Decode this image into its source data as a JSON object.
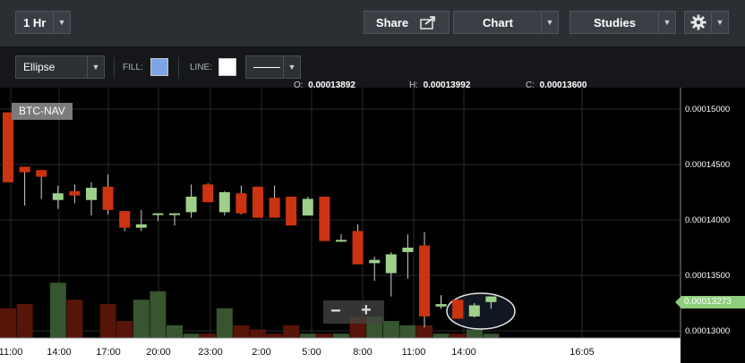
{
  "topbar": {
    "interval": "1 Hr",
    "share": "Share",
    "chart": "Chart",
    "studies": "Studies"
  },
  "drawing_toolbar": {
    "tool": "Ellipse",
    "fill_label": "FILL:",
    "line_label": "LINE:",
    "fill_color": "#7fa4e8",
    "line_color": "#ffffff"
  },
  "ohlc": {
    "o_label": "O:",
    "o_value": "0.00013892",
    "h_label": "H:",
    "h_value": "0.00013992",
    "c_label": "C:",
    "c_value": "0.00013600"
  },
  "chart_data": {
    "type": "candlestick",
    "symbol": "BTC-NAV",
    "current_price_label": "0.00013273",
    "y_ticks": [
      "0.00015000",
      "0.00014500",
      "0.00014000",
      "0.00013500",
      "0.00013000"
    ],
    "y_tick_values": [
      0.00015,
      0.000145,
      0.00014,
      0.000135,
      0.00013
    ],
    "x_ticks": [
      "11:00",
      "14:00",
      "17:00",
      "20:00",
      "23:00",
      "2:00",
      "5:00",
      "8:00",
      "11:00",
      "14:00",
      "16:05"
    ],
    "up_color": "#9ed08a",
    "down_color": "#cc3311",
    "zoom_out": "−",
    "zoom_in": "+",
    "candles": [
      {
        "o": 0.0001497,
        "h": 0.0001497,
        "l": 0.0001434,
        "c": 0.0001434
      },
      {
        "o": 0.0001448,
        "h": 0.0001448,
        "l": 0.0001413,
        "c": 0.0001443
      },
      {
        "o": 0.0001445,
        "h": 0.0001445,
        "l": 0.0001419,
        "c": 0.0001439
      },
      {
        "o": 0.0001418,
        "h": 0.0001431,
        "l": 0.000141,
        "c": 0.0001424
      },
      {
        "o": 0.0001426,
        "h": 0.0001432,
        "l": 0.0001415,
        "c": 0.0001422
      },
      {
        "o": 0.0001418,
        "h": 0.0001434,
        "l": 0.0001404,
        "c": 0.0001429
      },
      {
        "o": 0.000143,
        "h": 0.0001441,
        "l": 0.0001405,
        "c": 0.0001409
      },
      {
        "o": 0.0001408,
        "h": 0.0001408,
        "l": 0.000139,
        "c": 0.0001393
      },
      {
        "o": 0.0001393,
        "h": 0.0001409,
        "l": 0.000139,
        "c": 0.0001396
      },
      {
        "o": 0.0001406,
        "h": 0.0001406,
        "l": 0.0001399,
        "c": 0.0001406
      },
      {
        "o": 0.0001406,
        "h": 0.0001406,
        "l": 0.0001395,
        "c": 0.0001406
      },
      {
        "o": 0.0001407,
        "h": 0.0001432,
        "l": 0.0001402,
        "c": 0.0001421
      },
      {
        "o": 0.0001432,
        "h": 0.0001433,
        "l": 0.0001416,
        "c": 0.0001416
      },
      {
        "o": 0.0001407,
        "h": 0.0001426,
        "l": 0.0001404,
        "c": 0.0001425
      },
      {
        "o": 0.0001424,
        "h": 0.0001431,
        "l": 0.0001405,
        "c": 0.0001406
      },
      {
        "o": 0.000143,
        "h": 0.000143,
        "l": 0.0001402,
        "c": 0.0001402
      },
      {
        "o": 0.000142,
        "h": 0.0001431,
        "l": 0.0001402,
        "c": 0.0001402
      },
      {
        "o": 0.0001421,
        "h": 0.0001421,
        "l": 0.0001395,
        "c": 0.0001395
      },
      {
        "o": 0.0001404,
        "h": 0.0001421,
        "l": 0.0001404,
        "c": 0.0001419
      },
      {
        "o": 0.0001421,
        "h": 0.0001421,
        "l": 0.0001381,
        "c": 0.0001381
      },
      {
        "o": 0.0001382,
        "h": 0.0001387,
        "l": 0.000138,
        "c": 0.0001382
      },
      {
        "o": 0.000139,
        "h": 0.0001396,
        "l": 0.000136,
        "c": 0.000136
      },
      {
        "o": 0.0001361,
        "h": 0.0001367,
        "l": 0.0001345,
        "c": 0.0001364
      },
      {
        "o": 0.0001352,
        "h": 0.0001371,
        "l": 0.0001331,
        "c": 0.0001369
      },
      {
        "o": 0.0001371,
        "h": 0.0001387,
        "l": 0.0001347,
        "c": 0.0001375
      },
      {
        "o": 0.0001377,
        "h": 0.0001389,
        "l": 0.0001303,
        "c": 0.0001313
      },
      {
        "o": 0.0001322,
        "h": 0.0001332,
        "l": 0.000132,
        "c": 0.0001324
      },
      {
        "o": 0.0001328,
        "h": 0.0001328,
        "l": 0.0001311,
        "c": 0.0001311
      },
      {
        "o": 0.0001313,
        "h": 0.0001325,
        "l": 0.0001312,
        "c": 0.0001323
      },
      {
        "o": 0.0001326,
        "h": 0.0001331,
        "l": 0.000132,
        "c": 0.0001331
      }
    ],
    "volumes": [
      35,
      40,
      0,
      65,
      45,
      0,
      40,
      20,
      45,
      55,
      15,
      5,
      5,
      35,
      15,
      10,
      5,
      15,
      5,
      5,
      5,
      25,
      25,
      20,
      15,
      15,
      5,
      5,
      10,
      5
    ],
    "annotation": {
      "type": "ellipse"
    }
  }
}
